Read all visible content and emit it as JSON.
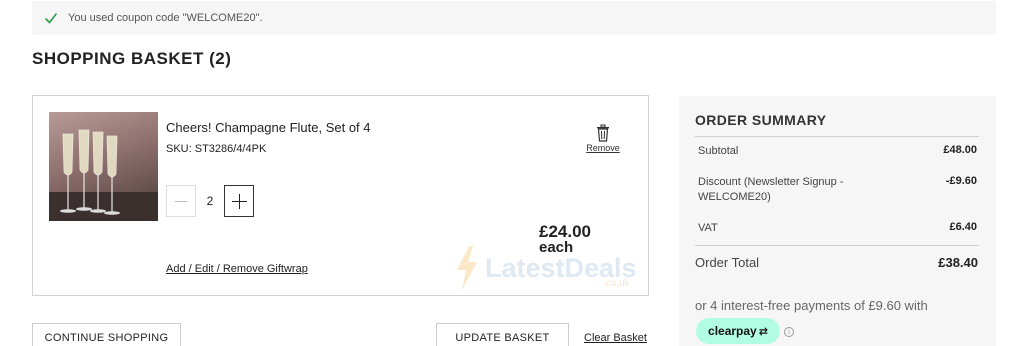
{
  "notice": {
    "message": "You used coupon code \"WELCOME20\"."
  },
  "page": {
    "title": "SHOPPING BASKET (2)"
  },
  "item": {
    "name": "Cheers! Champagne Flute, Set of 4",
    "sku": "SKU: ST3286/4/4PK",
    "quantity": "2",
    "remove_label": "Remove",
    "price": "£24.00",
    "price_unit": "each",
    "giftwrap_link": "Add / Edit / Remove Giftwrap"
  },
  "watermark": {
    "text": "LatestDeals",
    "sub": ".co.uk"
  },
  "actions": {
    "continue_label": "CONTINUE SHOPPING",
    "update_label": "UPDATE BASKET",
    "clear_label": "Clear Basket"
  },
  "summary": {
    "title": "ORDER SUMMARY",
    "rows": [
      {
        "label": "Subtotal",
        "value": "£48.00"
      },
      {
        "label": "Discount (Newsletter Signup - WELCOME20)",
        "value": "-£9.60"
      },
      {
        "label": "VAT",
        "value": "£6.40"
      }
    ],
    "total_label": "Order Total",
    "total_value": "£38.40",
    "installments": "or 4 interest-free payments of £9.60 with",
    "clearpay": "clearpay",
    "info": "i"
  },
  "colors": {
    "check": "#2e9e4a",
    "clearpay_badge": "#b2fce4",
    "panel_bg": "#f6f6f7"
  }
}
